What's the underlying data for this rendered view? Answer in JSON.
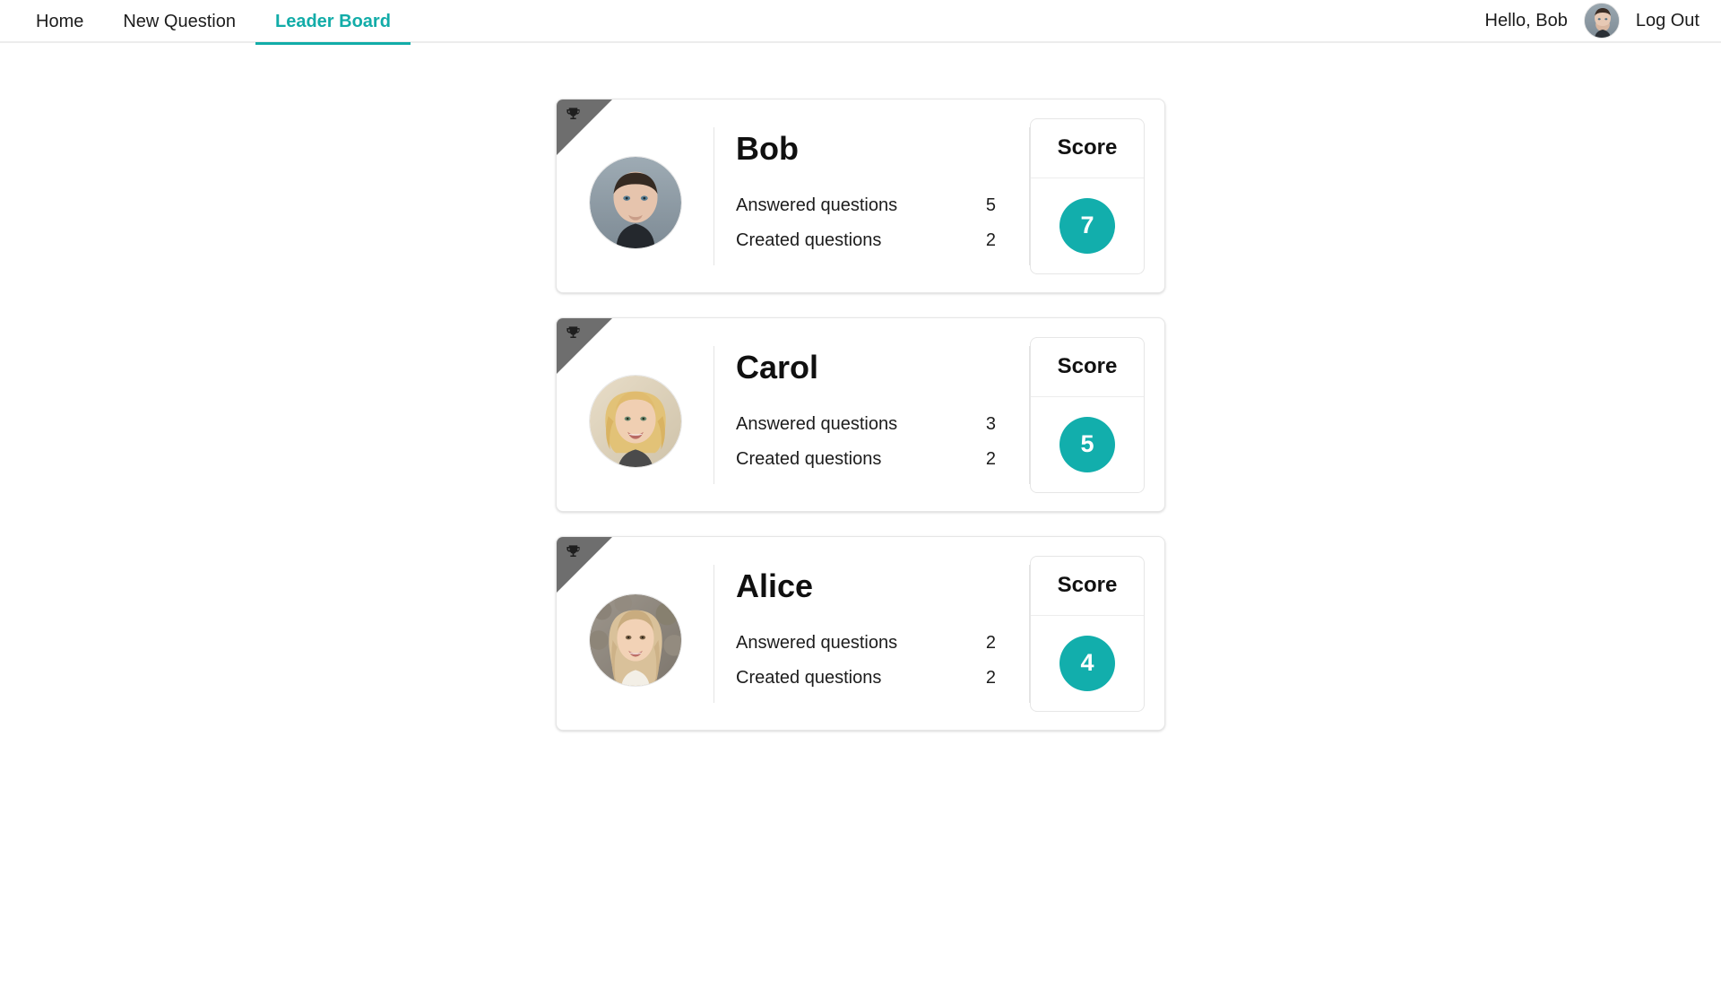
{
  "nav": {
    "items": [
      {
        "label": "Home",
        "active": false,
        "name": "nav-item-home"
      },
      {
        "label": "New Question",
        "active": false,
        "name": "nav-item-new-question"
      },
      {
        "label": "Leader Board",
        "active": true,
        "name": "nav-item-leader-board"
      }
    ],
    "greeting": "Hello, Bob",
    "logout_label": "Log Out",
    "avatar_icon": "user-avatar-image",
    "active_color": "#12aca8"
  },
  "leaderboard": {
    "score_title": "Score",
    "answered_label": "Answered questions",
    "created_label": "Created questions",
    "trophy_icon": "trophy-icon",
    "badge_color": "#12aeac",
    "ribbon_color": "#6e6e6e",
    "users": [
      {
        "name": "Bob",
        "answered": "5",
        "created": "2",
        "score": "7",
        "avatar_icon": "bob-avatar-image"
      },
      {
        "name": "Carol",
        "answered": "3",
        "created": "2",
        "score": "5",
        "avatar_icon": "carol-avatar-image"
      },
      {
        "name": "Alice",
        "answered": "2",
        "created": "2",
        "score": "4",
        "avatar_icon": "alice-avatar-image"
      }
    ]
  }
}
